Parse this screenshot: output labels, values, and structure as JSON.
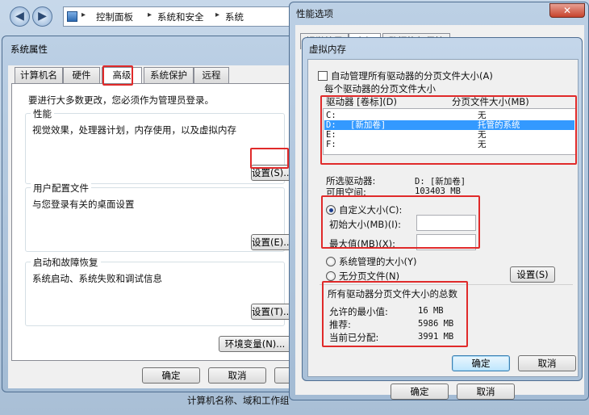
{
  "explorer": {
    "breadcrumb": [
      "控制面板",
      "系统和安全",
      "系统"
    ],
    "bottom_text": "计算机名称、域和工作组"
  },
  "sysprops": {
    "title": "系统属性",
    "tabs": [
      "计算机名",
      "硬件",
      "高级",
      "系统保护",
      "远程"
    ],
    "admin_note": "要进行大多数更改，您必须作为管理员登录。",
    "performance": {
      "title": "性能",
      "desc": "视觉效果，处理器计划，内存使用，以及虚拟内存",
      "button": "设置(S)..."
    },
    "profiles": {
      "title": "用户配置文件",
      "desc": "与您登录有关的桌面设置",
      "button": "设置(E)..."
    },
    "startup": {
      "title": "启动和故障恢复",
      "desc": "系统启动、系统失败和调试信息",
      "button": "设置(T)..."
    },
    "env_button": "环境变量(N)...",
    "ok": "确定",
    "cancel": "取消"
  },
  "perfopts": {
    "title": "性能选项",
    "tabs": [
      "视觉效果",
      "高级",
      "数据执行保护"
    ],
    "ok": "确定",
    "cancel": "取消"
  },
  "vmem": {
    "title": "虚拟内存",
    "auto_manage": "自动管理所有驱动器的分页文件大小(A)",
    "per_drive": "每个驱动器的分页文件大小",
    "col_drive": "驱动器 [卷标](D)",
    "col_size": "分页文件大小(MB)",
    "drives": [
      {
        "drive": "C:",
        "label": "",
        "size": "无"
      },
      {
        "drive": "D:",
        "label": "[新加卷]",
        "size": "托管的系统"
      },
      {
        "drive": "E:",
        "label": "",
        "size": "无"
      },
      {
        "drive": "F:",
        "label": "",
        "size": "无"
      }
    ],
    "selected_label": "所选驱动器:",
    "selected_value": "D:  [新加卷]",
    "free_label": "可用空间:",
    "free_value": "103403 MB",
    "custom_size": "自定义大小(C):",
    "initial_size": "初始大小(MB)(I):",
    "max_size": "最大值(MB)(X):",
    "system_managed": "系统管理的大小(Y)",
    "no_paging": "无分页文件(N)",
    "set_button": "设置(S)",
    "totals_title": "所有驱动器分页文件大小的总数",
    "min_label": "允许的最小值:",
    "min_value": "16 MB",
    "rec_label": "推荐:",
    "rec_value": "5986 MB",
    "cur_label": "当前已分配:",
    "cur_value": "3991 MB",
    "ok": "确定",
    "cancel": "取消"
  }
}
